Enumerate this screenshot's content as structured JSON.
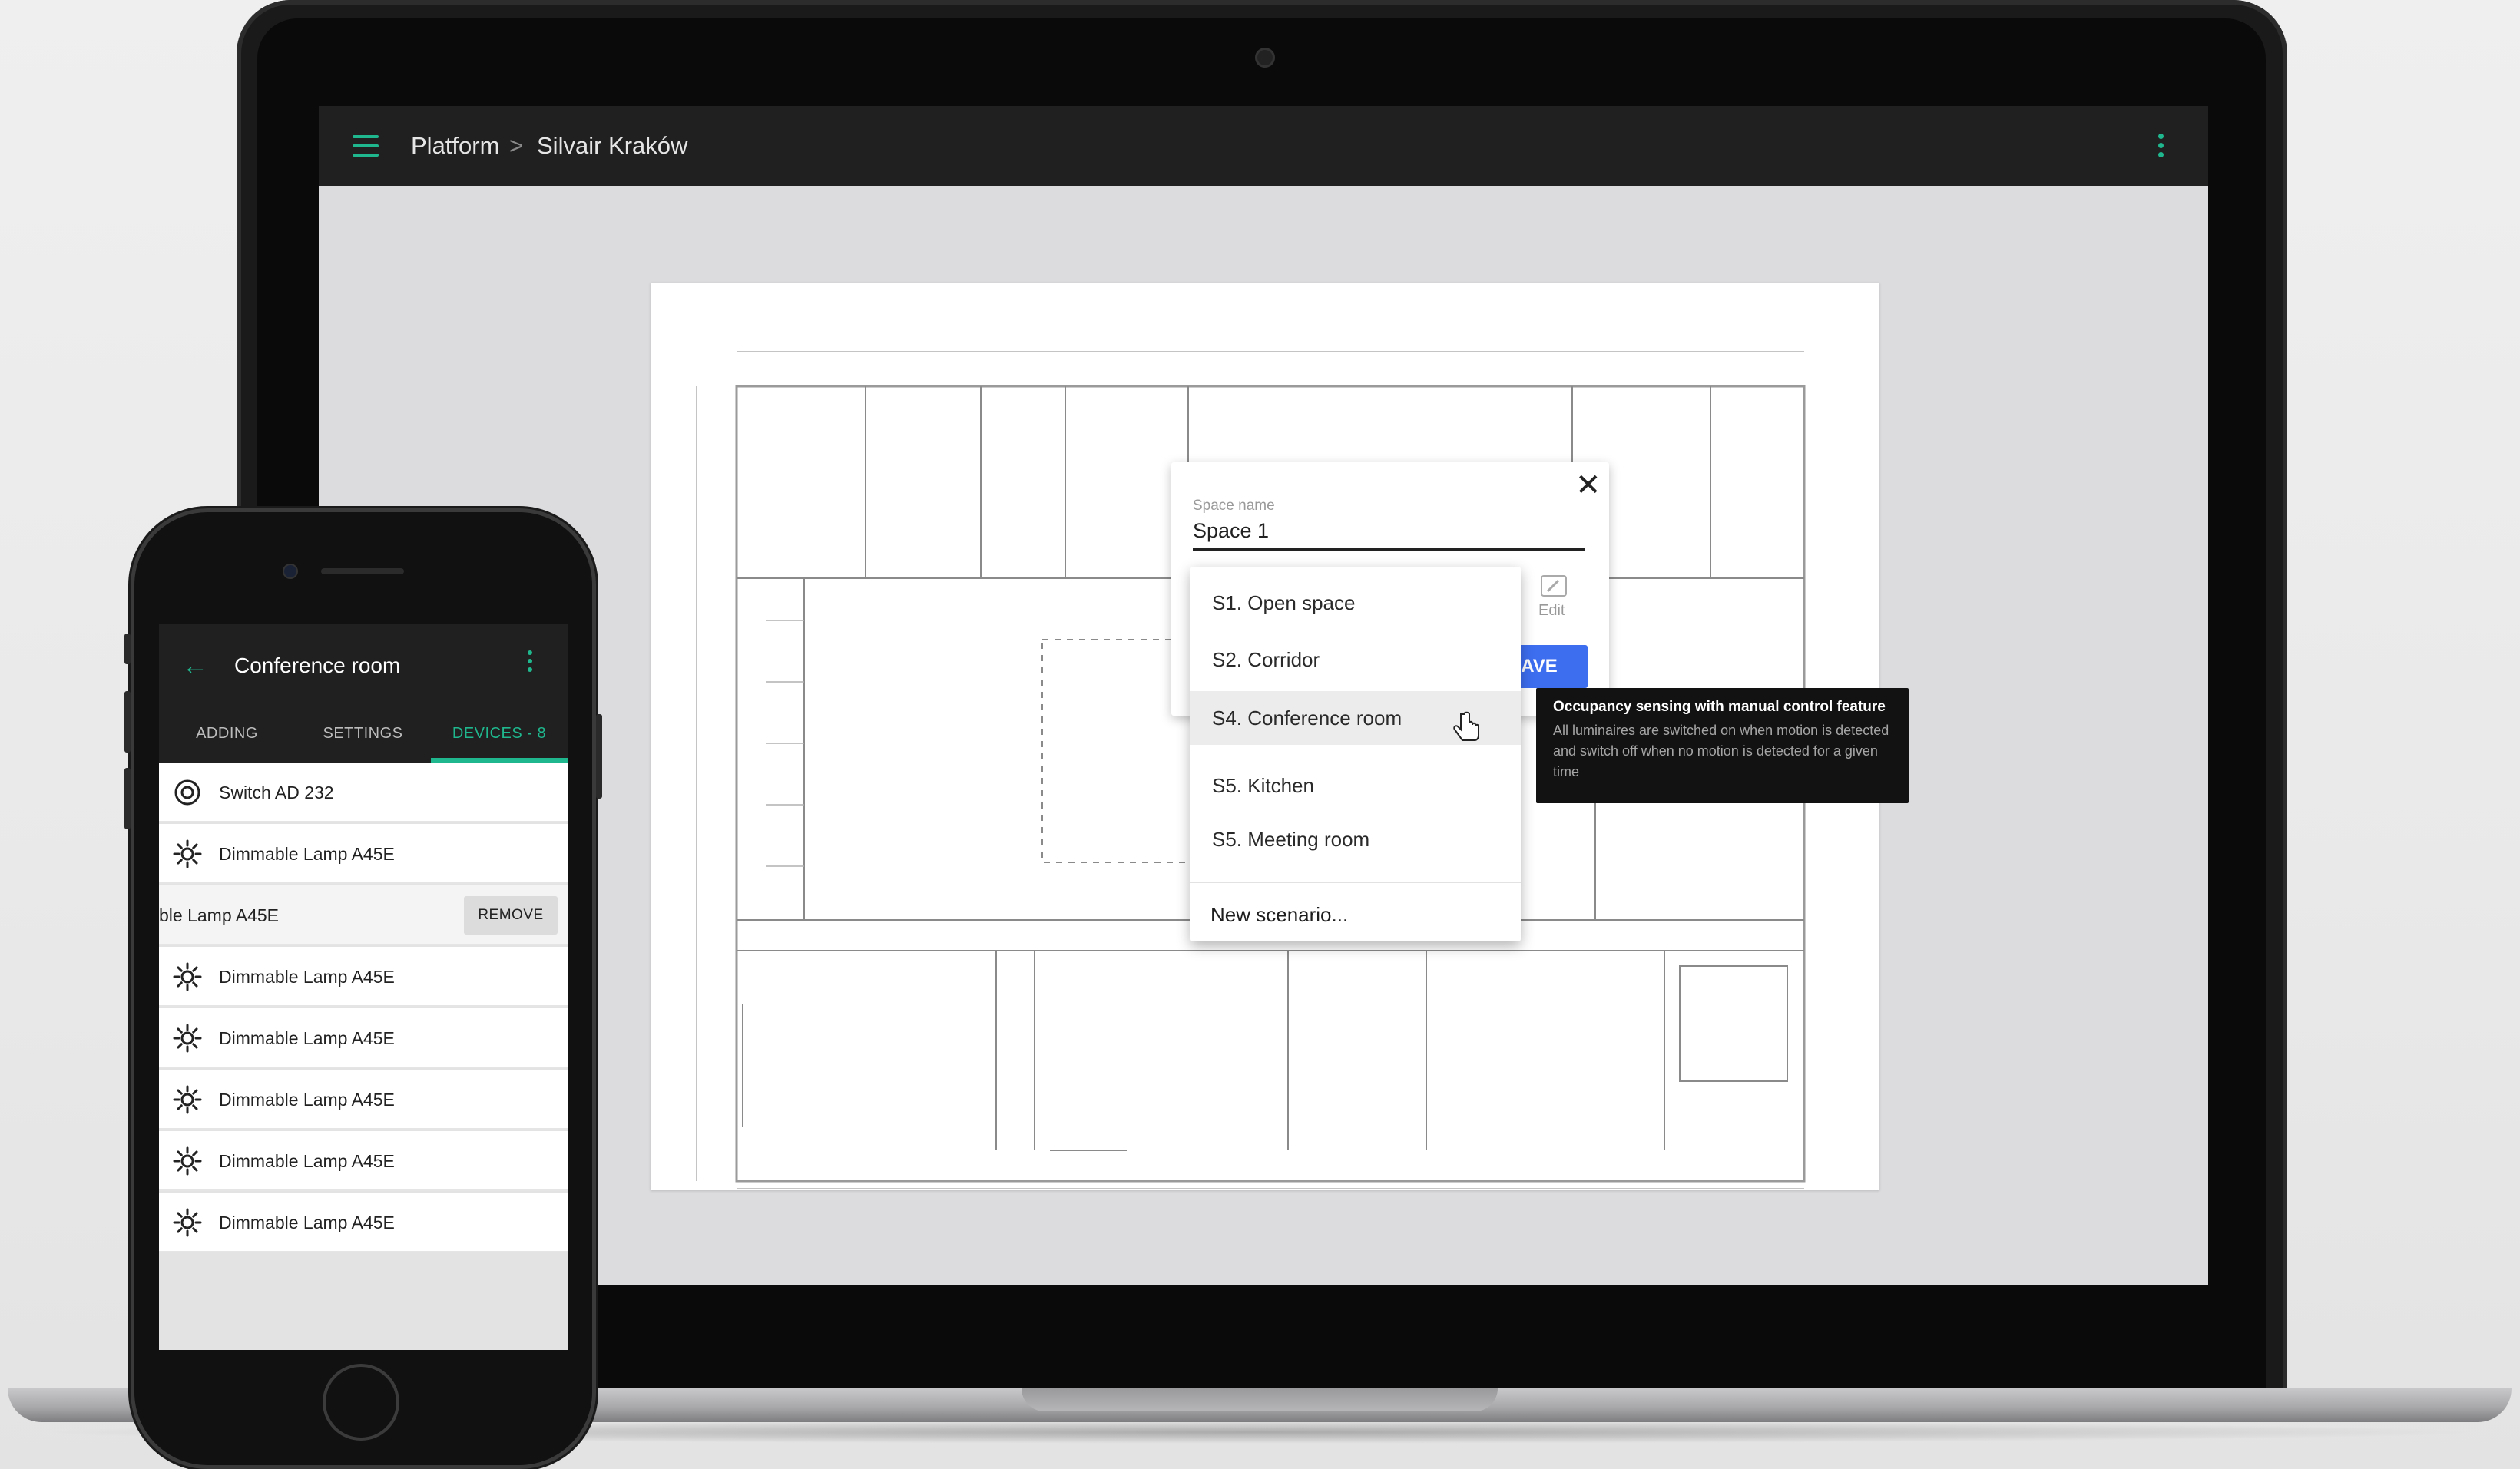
{
  "laptop": {
    "breadcrumb": {
      "root": "Platform",
      "separator": ">",
      "current": "Silvair Kraków"
    },
    "space_dialog": {
      "field_label": "Space name",
      "field_value": "Space 1",
      "edit_label": "Edit",
      "save_label": "SAVE"
    },
    "scenario_menu": {
      "items": [
        {
          "label": "S1. Open space"
        },
        {
          "label": "S2. Corridor"
        },
        {
          "label": "S4. Conference room",
          "highlighted": true
        },
        {
          "label": "S5. Kitchen"
        },
        {
          "label": "S5. Meeting room"
        }
      ],
      "new_item": "New scenario..."
    },
    "tooltip": {
      "title": "Occupancy sensing with manual control feature",
      "body": "All luminaires are switched on when motion is detected and switch off when no motion is detected for a given time"
    }
  },
  "phone": {
    "title": "Conference room",
    "tabs": [
      {
        "label": "ADDING"
      },
      {
        "label": "SETTINGS"
      },
      {
        "label": "DEVICES - 8",
        "active": true
      }
    ],
    "devices": [
      {
        "label": "Switch AD 232",
        "icon": "switch-icon"
      },
      {
        "label": "Dimmable Lamp A45E",
        "icon": "lamp-icon"
      },
      {
        "label": "ble Lamp A45E",
        "icon": "lamp-icon",
        "swiped": true,
        "action": "REMOVE"
      },
      {
        "label": "Dimmable Lamp A45E",
        "icon": "lamp-icon"
      },
      {
        "label": "Dimmable Lamp A45E",
        "icon": "lamp-icon"
      },
      {
        "label": "Dimmable Lamp A45E",
        "icon": "lamp-icon"
      },
      {
        "label": "Dimmable Lamp A45E",
        "icon": "lamp-icon"
      },
      {
        "label": "Dimmable Lamp A45E",
        "icon": "lamp-icon"
      }
    ]
  },
  "colors": {
    "accent": "#1fb88e",
    "save_button": "#3d6ef0",
    "app_bar": "#202020"
  }
}
